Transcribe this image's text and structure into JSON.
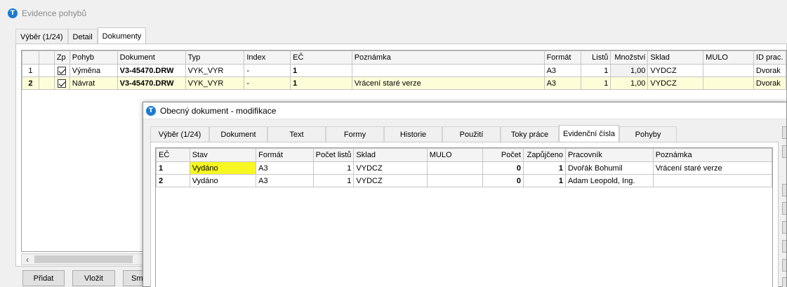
{
  "window": {
    "title": "Evidence pohybů",
    "icon": "app-logo-icon"
  },
  "outer_tabs": [
    {
      "label": "Výběr (1/24)",
      "active": false
    },
    {
      "label": "Detail",
      "active": false
    },
    {
      "label": "Dokumenty",
      "active": true
    }
  ],
  "outer_table": {
    "columns": [
      "",
      "",
      "Zp",
      "Pohyb",
      "Dokument",
      "Typ",
      "Index",
      "EČ",
      "Poznámka",
      "Formát",
      "Listů",
      "Množství",
      "Sklad",
      "MULO",
      "ID prac."
    ],
    "rows": [
      {
        "num": "1",
        "zp": true,
        "pohyb": "Výměna",
        "dokument": "V3-45470.DRW",
        "typ": "VYK_VYR",
        "index": "-",
        "ec": "1",
        "poznamka": "",
        "format": "A3",
        "listu": "1",
        "mnozstvi": "1,00",
        "sklad": "VYDCZ",
        "mulo": "",
        "id_prac": "Dvorak",
        "selected": false
      },
      {
        "num": "2",
        "zp": true,
        "pohyb": "Návrat",
        "dokument": "V3-45470.DRW",
        "typ": "VYK_VYR",
        "index": "-",
        "ec": "1",
        "poznamka": "Vrácení staré verze",
        "format": "A3",
        "listu": "1",
        "mnozstvi": "1,00",
        "sklad": "VYDCZ",
        "mulo": "",
        "id_prac": "Dvorak",
        "selected": true
      }
    ]
  },
  "scroll_left_glyph": "‹",
  "buttons": {
    "pridat": "Přidat",
    "vlozit": "Vložit",
    "smazat": "Sm"
  },
  "dialog": {
    "title": "Obecný dokument - modifikace",
    "tabs": [
      {
        "label": "Výběr (1/24)",
        "active": false
      },
      {
        "label": "Dokument",
        "active": false
      },
      {
        "label": "Text",
        "active": false
      },
      {
        "label": "Formy",
        "active": false
      },
      {
        "label": "Historie",
        "active": false
      },
      {
        "label": "Použití",
        "active": false
      },
      {
        "label": "Toky práce",
        "active": false
      },
      {
        "label": "Evidenční čísla",
        "active": true
      },
      {
        "label": "Pohyby",
        "active": false
      }
    ],
    "table": {
      "columns": [
        "EČ",
        "Stav",
        "Formát",
        "Počet listů",
        "Sklad",
        "MULO",
        "Počet",
        "Zapůjčeno",
        "Pracovník",
        "Poznámka"
      ],
      "rows": [
        {
          "ec": "1",
          "stav": "Vydáno",
          "format": "A3",
          "pocet_listu": "1",
          "sklad": "VYDCZ",
          "mulo": "",
          "pocet": "0",
          "zapujceno": "1",
          "pracovnik": "Dvořák Bohumil",
          "poznamka": "Vrácení staré verze",
          "selected": true
        },
        {
          "ec": "2",
          "stav": "Vydáno",
          "format": "A3",
          "pocet_listu": "1",
          "sklad": "VYDCZ",
          "mulo": "",
          "pocet": "0",
          "zapujceno": "1",
          "pracovnik": "Adam Leopold, Ing.",
          "poznamka": "",
          "selected": false
        }
      ]
    }
  },
  "colors": {
    "selected_row": "#fdfdd8",
    "highlight_cell": "#f7f722",
    "icon_blue": "#1c7bd0"
  }
}
